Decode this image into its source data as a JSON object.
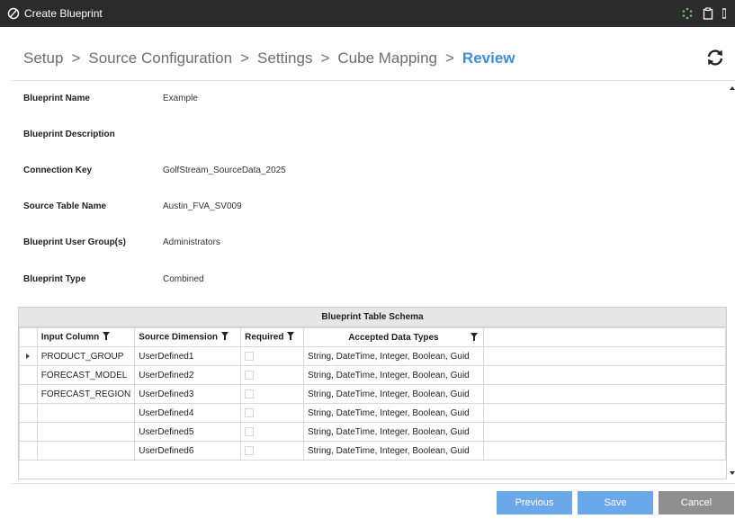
{
  "window": {
    "title": "Create Blueprint"
  },
  "nav": {
    "steps": [
      {
        "label": "Setup"
      },
      {
        "label": "Source Configuration"
      },
      {
        "label": "Settings"
      },
      {
        "label": "Cube Mapping"
      },
      {
        "label": "Review",
        "active": true
      }
    ],
    "separator": ">"
  },
  "fields": [
    {
      "label": "Blueprint Name",
      "value": "Example"
    },
    {
      "label": "Blueprint Description",
      "value": ""
    },
    {
      "label": "Connection Key",
      "value": "GolfStream_SourceData_2025"
    },
    {
      "label": "Source Table Name",
      "value": "Austin_FVA_SV009"
    },
    {
      "label": "Blueprint User Group(s)",
      "value": "Administrators"
    },
    {
      "label": "Blueprint Type",
      "value": "Combined"
    }
  ],
  "schema": {
    "title": "Blueprint Table Schema",
    "columns": [
      "Input Column",
      "Source Dimension",
      "Required",
      "Accepted Data Types"
    ],
    "rows": [
      {
        "input": "PRODUCT_GROUP",
        "source": "UserDefined1",
        "required": false,
        "types": "String, DateTime, Integer, Boolean, Guid"
      },
      {
        "input": "FORECAST_MODEL",
        "source": "UserDefined2",
        "required": false,
        "types": "String, DateTime, Integer, Boolean, Guid"
      },
      {
        "input": "FORECAST_REGION",
        "source": "UserDefined3",
        "required": false,
        "types": "String, DateTime, Integer, Boolean, Guid"
      },
      {
        "input": "",
        "source": "UserDefined4",
        "required": false,
        "types": "String, DateTime, Integer, Boolean, Guid"
      },
      {
        "input": "",
        "source": "UserDefined5",
        "required": false,
        "types": "String, DateTime, Integer, Boolean, Guid"
      },
      {
        "input": "",
        "source": "UserDefined6",
        "required": false,
        "types": "String, DateTime, Integer, Boolean, Guid"
      }
    ]
  },
  "buttons": {
    "previous": "Previous",
    "save": "Save",
    "cancel": "Cancel"
  },
  "colors": {
    "active_step": "#3d8ed8",
    "primary_button": "#6aa8ea",
    "cancel_button": "#8f8f8f",
    "titlebar": "#2b2b2b"
  }
}
